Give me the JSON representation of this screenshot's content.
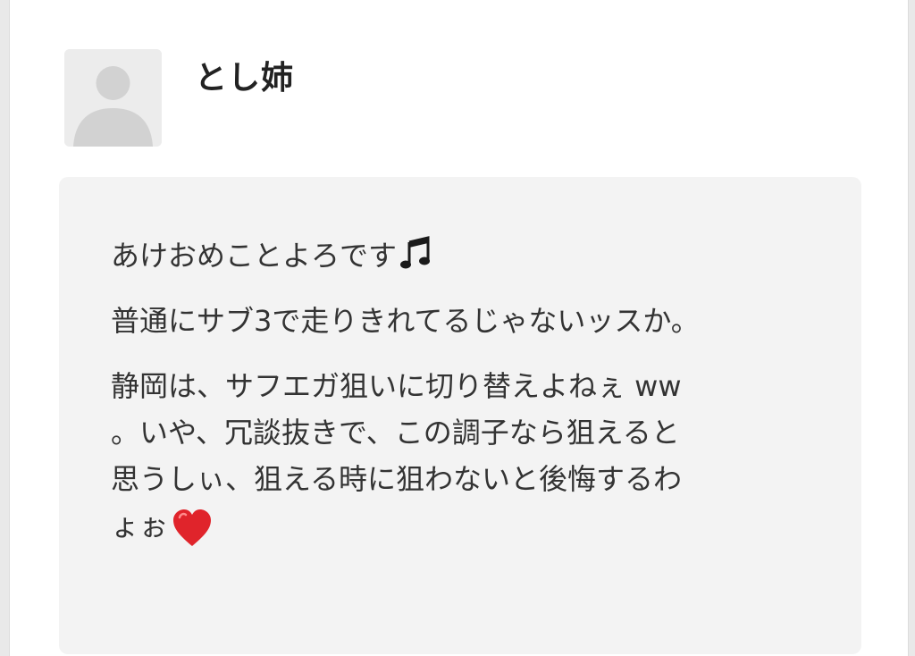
{
  "comment": {
    "author": "とし姉",
    "avatar_icon": "default-user-silhouette-icon",
    "paragraphs": [
      {
        "text": "あけおめことよろです",
        "emoji": "music-note-icon"
      },
      {
        "text": "普通にサブ3で走りきれてるじゃないッスか。"
      },
      {
        "text": "静岡は、サフエガ狙いに切り替えよねぇ ww\n。いや、冗談抜きで、この調子なら狙えると\n思うしぃ、狙える時に狙わないと後悔するわ\nょぉ",
        "emoji": "red-heart-icon"
      }
    ]
  },
  "colors": {
    "comment_background": "#f3f3f3",
    "heart": "#e0242b",
    "text": "#333333"
  }
}
